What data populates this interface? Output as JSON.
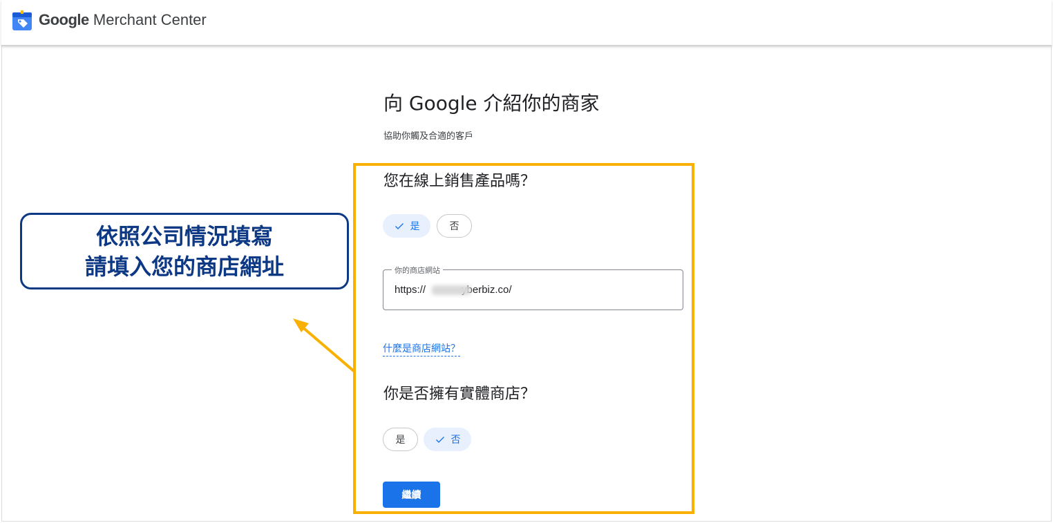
{
  "header": {
    "brand_google": "Google",
    "brand_product": " Merchant Center"
  },
  "main": {
    "title": "向 Google 介紹你的商家",
    "subtitle": "協助你觸及合適的客戶",
    "online_question": {
      "label": "您在線上銷售產品嗎？",
      "yes": "是",
      "no": "否",
      "selected": "yes"
    },
    "website_field": {
      "label": "你的商店網站",
      "value_prefix": "https://",
      "value_suffix": "yberbiz.co/"
    },
    "help_link": "什麼是商店網站？",
    "store_question": {
      "label": "你是否擁有實體商店？",
      "yes": "是",
      "no": "否",
      "selected": "no"
    },
    "continue_label": "繼續"
  },
  "annotation": {
    "line1": "依照公司情況填寫",
    "line2": "請填入您的商店網址"
  },
  "colors": {
    "accent": "#1a73e8",
    "chip_selected_bg": "#e8f0fe",
    "highlight": "#f9b000",
    "callout": "#0d3884"
  },
  "icons": {
    "logo": "merchant-center-tag-icon",
    "check": "check-icon"
  }
}
